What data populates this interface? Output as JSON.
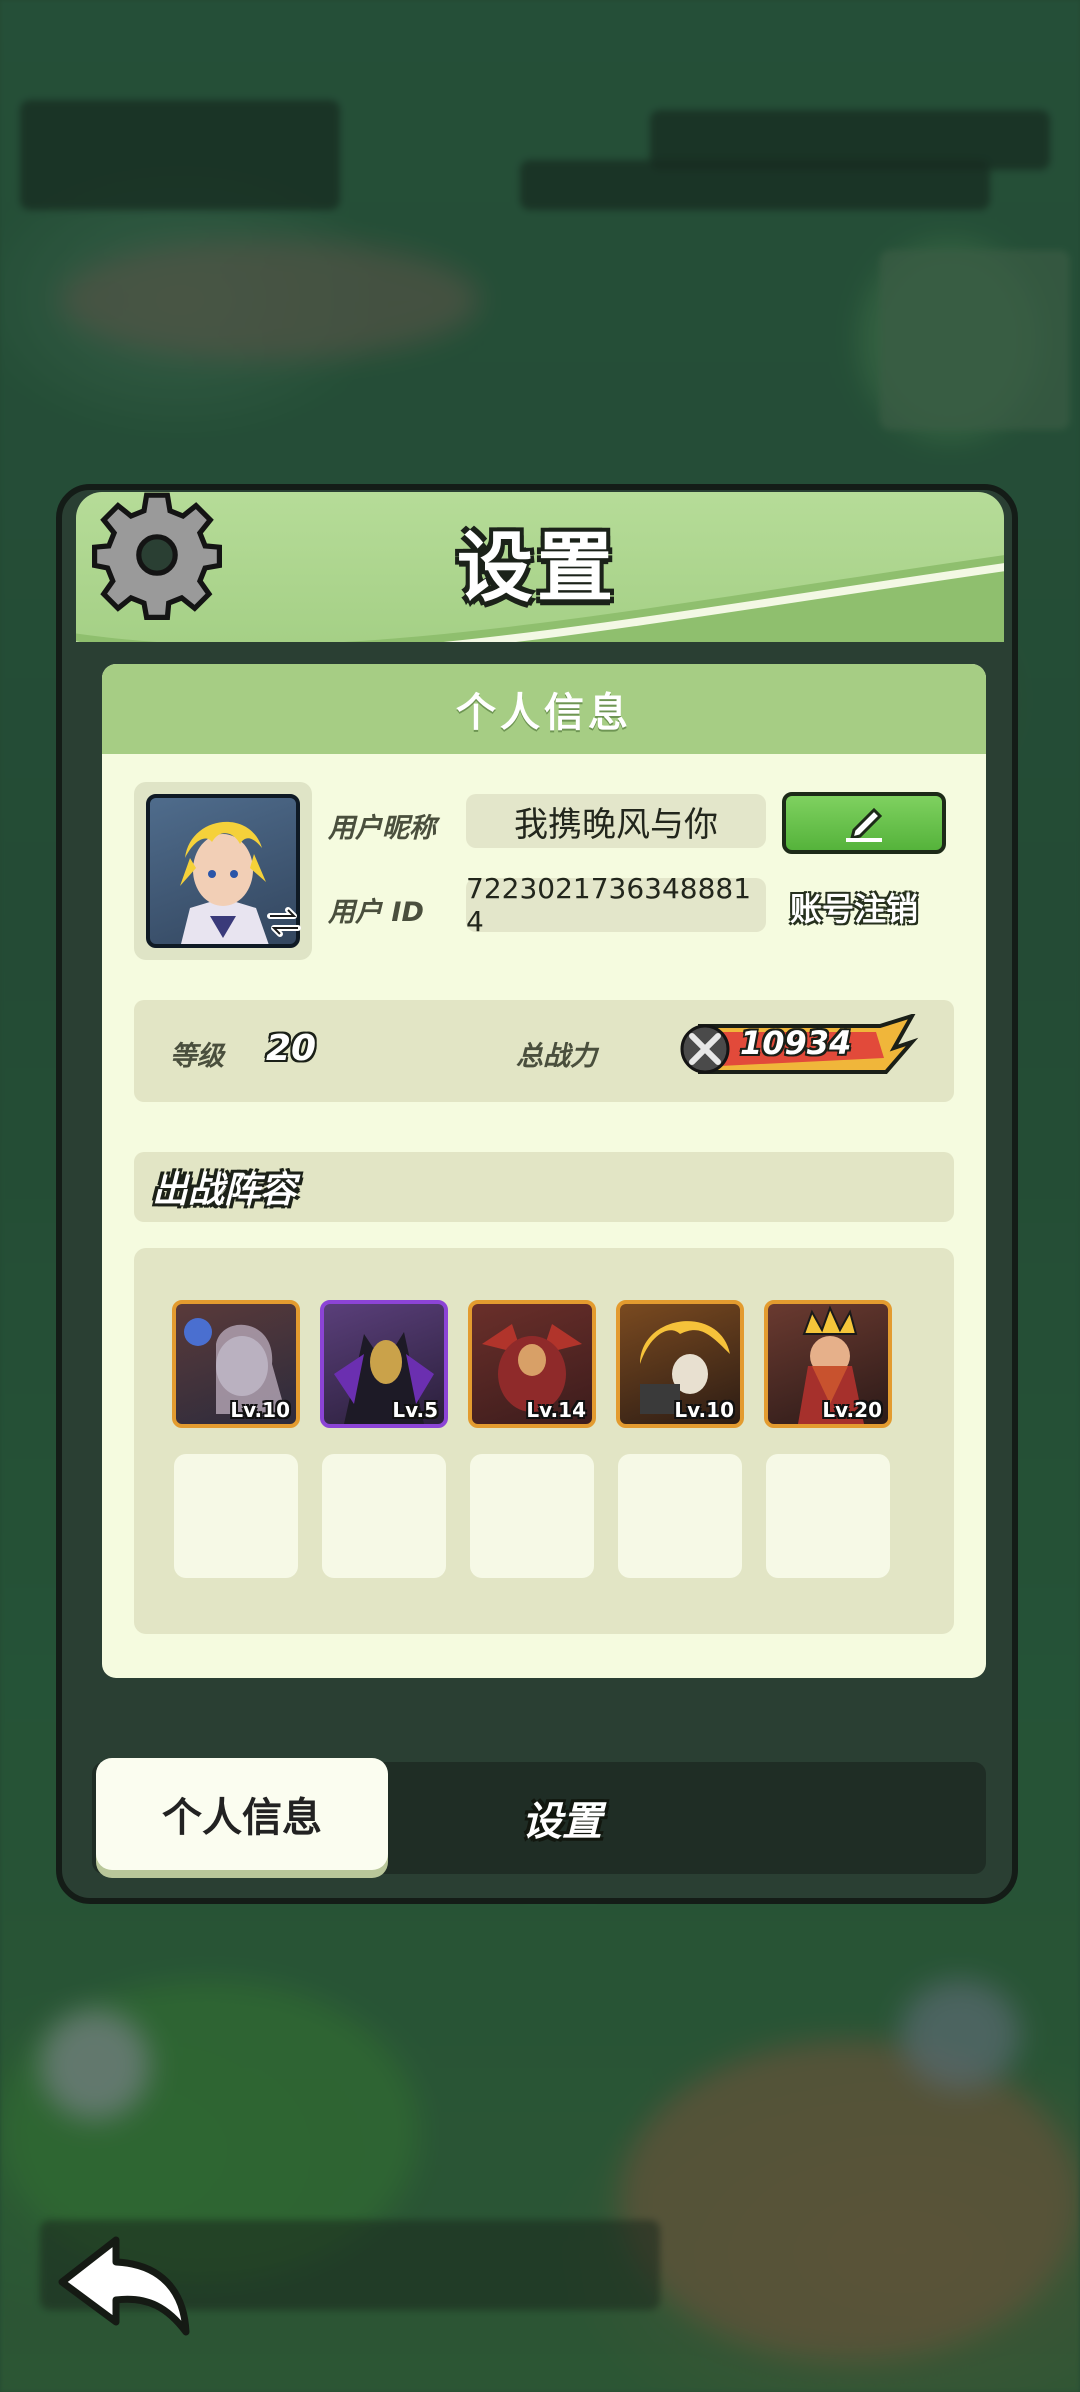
{
  "window": {
    "title": "设置"
  },
  "profile_card": {
    "header": "个人信息",
    "nickname_label": "用户昵称",
    "nickname_value": "我携晚风与你",
    "id_label": "用户 ID",
    "id_value": "7223021736348881​4",
    "account_cancel": "账号注销"
  },
  "stats": {
    "level_label": "等级",
    "level_value": "20",
    "power_label": "总战力",
    "power_value": "10934"
  },
  "lineup": {
    "title": "出战阵容",
    "heroes": [
      {
        "level": "Lv.10",
        "rarity": "orange"
      },
      {
        "level": "Lv.5",
        "rarity": "purple"
      },
      {
        "level": "Lv.14",
        "rarity": "orange"
      },
      {
        "level": "Lv.10",
        "rarity": "orange"
      },
      {
        "level": "Lv.20",
        "rarity": "orange"
      }
    ],
    "empty_slots": 5
  },
  "tabs": {
    "active": "个人信息",
    "other": "设置"
  },
  "icons": [
    "gear-icon",
    "swap-icon",
    "edit-icon",
    "crossed-swords-icon",
    "back-arrow-icon"
  ],
  "colors": {
    "accent_green": "#a6cd84",
    "button_green": "#55b33b",
    "panel_cream": "#f5fbdf",
    "rarity_orange": "#e39b2f",
    "rarity_purple": "#8c44d6"
  }
}
